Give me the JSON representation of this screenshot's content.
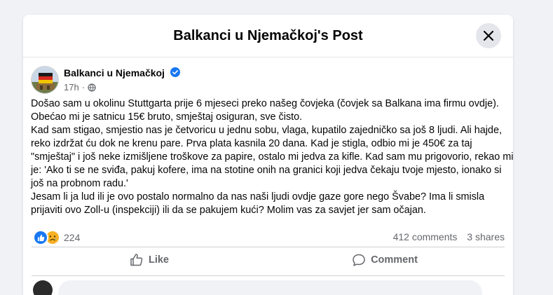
{
  "modal": {
    "title": "Balkanci u Njemačkoj's Post"
  },
  "post": {
    "author": "Balkanci u Njemačkoj",
    "verified": true,
    "time": "17h",
    "separator": "·",
    "privacy_icon": "globe-icon",
    "paragraphs": [
      "Došao sam u okolinu Stuttgarta prije 6 mjeseci preko našeg čovjeka (čovjek sa Balkana ima firmu ovdje). Obećao mi je satnicu 15€ bruto, smještaj osiguran, sve čisto.",
      "Kad sam stigao, smjestio nas je četvoricu u jednu sobu, vlaga, kupatilo zajedničko sa još 8 ljudi. Ali hajde, reko izdržat ću dok ne krenu pare. Prva plata kasnila 20 dana. Kad je stigla, odbio mi je 450€ za taj \"smještaj\" i još neke izmišljene troškove za papire, ostalo mi jedva za kifle. Kad sam mu prigovorio, rekao mi je: 'Ako ti se ne sviđa, pakuj kofere, ima na stotine onih na granici koji jedva čekaju tvoje mjesto, ionako si još na probnom radu.'",
      "Jesam li ja lud ili je ovo postalo normalno da nas naši ljudi ovdje gaze gore nego Švabe? Ima li smisla prijaviti ovo Zoll-u (inspekciji) ili da se pakujem kući? Molim vas za savjet jer sam očajan."
    ],
    "reactions": {
      "icons": [
        "like-icon",
        "sad-icon"
      ],
      "count": "224"
    },
    "comments_count": "412 comments",
    "shares_count": "3 shares"
  },
  "actions": {
    "like_label": "Like",
    "comment_label": "Comment"
  },
  "colors": {
    "page_bg": "#f0f2f5",
    "accent": "#1877f2",
    "muted_text": "#65676b",
    "sad_reaction": "#f7b125"
  }
}
